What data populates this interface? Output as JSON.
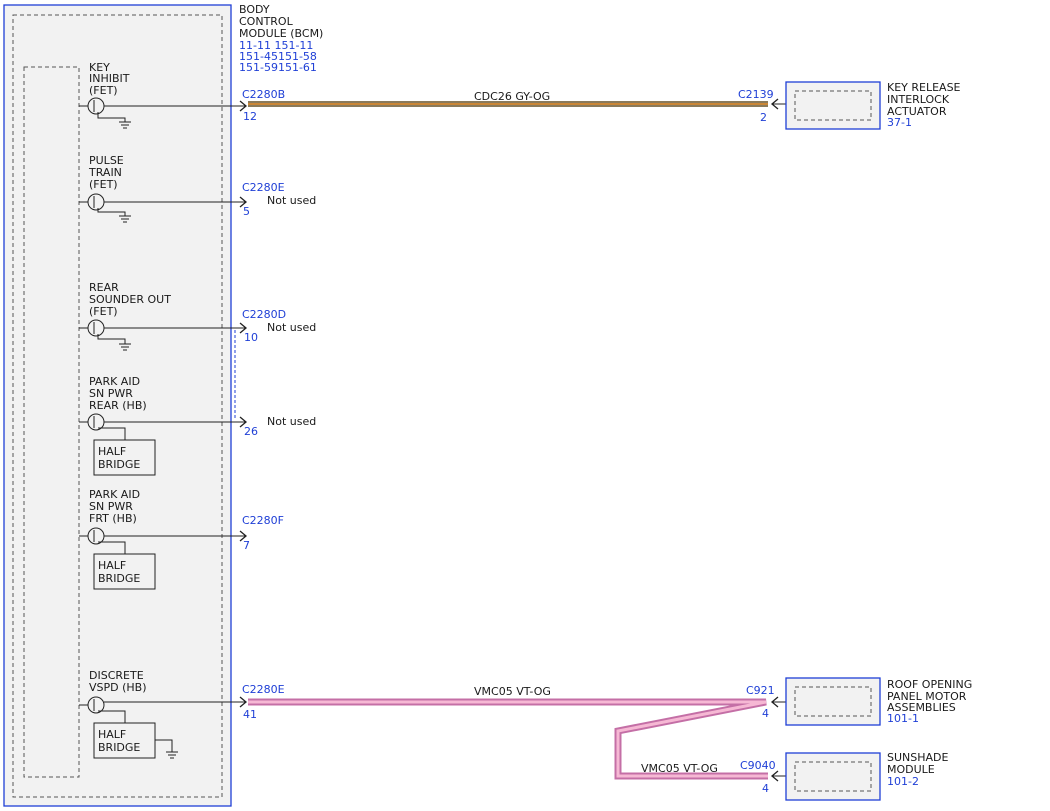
{
  "module": {
    "name_lines": [
      "BODY",
      "CONTROL",
      "MODULE (BCM)"
    ],
    "ref_lines": [
      "11-11  151-11",
      "151-45151-58",
      "151-59151-61"
    ]
  },
  "circuits": [
    {
      "label": [
        "KEY",
        "INHIBIT",
        "(FET)"
      ],
      "connector": "C2280B",
      "pin": "12",
      "status": ""
    },
    {
      "label": [
        "PULSE",
        "TRAIN",
        "(FET)"
      ],
      "connector": "C2280E",
      "pin": "5",
      "status": "Not used"
    },
    {
      "label": [
        "REAR",
        "SOUNDER OUT",
        "(FET)"
      ],
      "connector": "C2280D",
      "pin": "10",
      "status": "Not used"
    },
    {
      "label": [
        "PARK AID",
        "SN PWR",
        "REAR (HB)"
      ],
      "connector": "",
      "pin": "26",
      "status": "Not used"
    },
    {
      "label": [
        "PARK AID",
        "SN PWR",
        "FRT (HB)"
      ],
      "connector": "C2280F",
      "pin": "7",
      "status": ""
    },
    {
      "label": [
        "DISCRETE",
        "VSPD (HB)"
      ],
      "connector": "C2280E",
      "pin": "41",
      "status": ""
    }
  ],
  "half_bridge_label": [
    "HALF",
    "BRIDGE"
  ],
  "wires": [
    {
      "name": "CDC26  GY-OG",
      "color_main": "#8a7a5a",
      "color_stripe": "#e08a2a"
    },
    {
      "name": "VMC05  VT-OG",
      "color_main": "#d07ab0",
      "color_stripe": "#f6b8d4"
    },
    {
      "name": "VMC05  VT-OG",
      "color_main": "#d07ab0",
      "color_stripe": "#f6b8d4"
    }
  ],
  "components": [
    {
      "connector": "C2139",
      "pin": "2",
      "name": [
        "KEY RELEASE",
        "INTERLOCK",
        "ACTUATOR"
      ],
      "ref": "37-1"
    },
    {
      "connector": "C921",
      "pin": "4",
      "name": [
        "ROOF OPENING",
        "PANEL MOTOR",
        "ASSEMBLIES"
      ],
      "ref": "101-1"
    },
    {
      "connector": "C9040",
      "pin": "4",
      "name": [
        "SUNSHADE",
        "MODULE"
      ],
      "ref": "101-2"
    }
  ],
  "colors": {
    "blue": "#1f3fd6",
    "box_fill": "#f2f2f2"
  }
}
